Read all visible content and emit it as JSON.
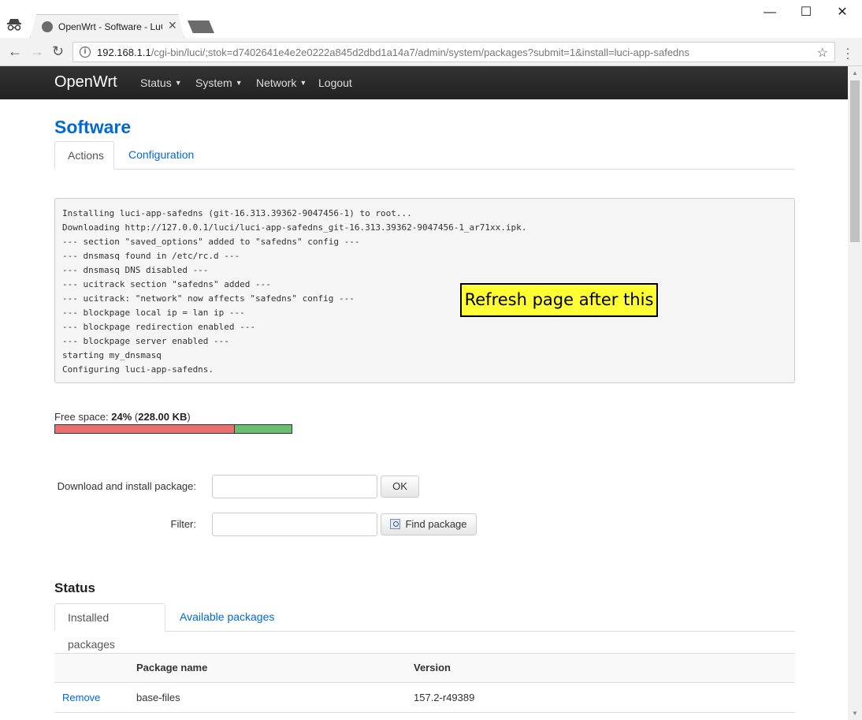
{
  "browser": {
    "tab_title": "OpenWrt - Software - LuCI",
    "tab_close": "✕",
    "url_host": "192.168.1.1",
    "url_path": "/cgi-bin/luci/;stok=d7402641e4e2e0222a845d2dbd1a14a7/admin/system/packages?submit=1&install=luci-app-safedns",
    "win_min": "—",
    "win_max": "☐",
    "win_close": "✕"
  },
  "navbar": {
    "brand": "OpenWrt",
    "items": [
      "Status",
      "System",
      "Network",
      "Logout"
    ]
  },
  "page": {
    "title": "Software",
    "tabs": [
      "Actions",
      "Configuration"
    ],
    "log_lines": [
      "Installing luci-app-safedns (git-16.313.39362-9047456-1) to root...",
      "Downloading http://127.0.0.1/luci/luci-app-safedns_git-16.313.39362-9047456-1_ar71xx.ipk.",
      "--- section \"saved_options\" added to \"safedns\" config ---",
      "--- dnsmasq found in /etc/rc.d ---",
      "--- dnsmasq DNS disabled ---",
      "--- ucitrack section \"safedns\" added ---",
      "--- ucitrack: \"network\" now affects \"safedns\" config ---",
      "--- blockpage local ip = lan ip ---",
      "--- blockpage redirection enabled ---",
      "--- blockpage server enabled ---",
      "starting my_dnsmasq",
      "Configuring luci-app-safedns."
    ],
    "annotation": "Refresh page after this",
    "free_space": {
      "label": "Free space: ",
      "percent": "24%",
      "size": "228.00 KB",
      "free_fraction": 0.24
    },
    "download": {
      "label": "Download and install package:",
      "value": "",
      "button": "OK"
    },
    "filter": {
      "label": "Filter:",
      "value": "",
      "button": "Find package"
    },
    "status": {
      "title": "Status",
      "tabs": [
        "Installed packages",
        "Available packages"
      ],
      "columns": [
        "",
        "Package name",
        "Version"
      ],
      "rows": [
        {
          "action": "Remove",
          "name": "base-files",
          "version": "157.2-r49389"
        }
      ]
    }
  },
  "colors": {
    "link": "#0069d6",
    "navbar": "#222222",
    "annotation_bg": "#ffff33",
    "bar_used": "#eb6f6f",
    "bar_free": "#6cbf6c"
  }
}
